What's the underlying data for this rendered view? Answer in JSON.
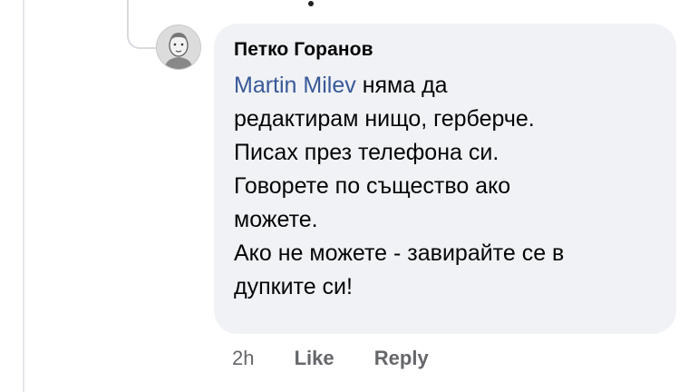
{
  "comment": {
    "author": "Петко Горанов",
    "mention": "Martin Milev",
    "lines": [
      " няма да",
      "редактирам нищо, герберче.",
      "Писах през телефона си.",
      "Говорете по същество ако",
      "можете.",
      "Ако не можете - завирайте се в",
      "дупките си!"
    ],
    "avatar_icon": "user-avatar-icon"
  },
  "actions": {
    "time": "2h",
    "like_label": "Like",
    "reply_label": "Reply"
  },
  "colors": {
    "bubble_bg": "#f0f2f5",
    "mention": "#385898",
    "action_text": "#65676b"
  }
}
